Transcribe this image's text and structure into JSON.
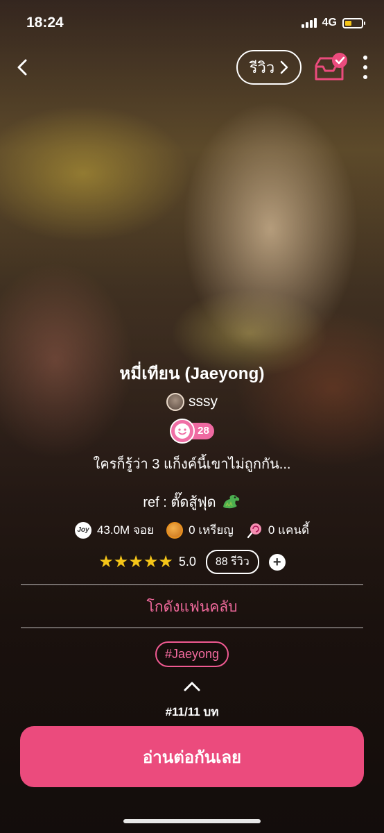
{
  "status_bar": {
    "time": "18:24",
    "network": "4G",
    "battery_color": "#f5c518"
  },
  "header": {
    "back_icon": "chevron-left-icon",
    "review_label": "รีวิว",
    "shelf_icon": "inbox-check-icon",
    "more_icon": "more-vertical-icon"
  },
  "story": {
    "title": "หมี่เทียน (Jaeyong)",
    "author": "sssy",
    "level": "28",
    "description": "ใครก็รู้ว่า 3 แก็งค์นี้เขาไม่ถูกกัน...",
    "ref": "ref : ตั๊ดสู้ฟุด",
    "ref_icon": "dragon-emoji-icon"
  },
  "stats": {
    "joy_icon_label": "Joy",
    "joy": "43.0M จอย",
    "coins": "0 เหรียญ",
    "candy": "0 แคนดี้"
  },
  "rating": {
    "stars": "★★★★★",
    "score": "5.0",
    "reviews": "88 รีวิว",
    "add": "+"
  },
  "fanclub_label": "โกดังแฟนคลับ",
  "tags": [
    "#Jaeyong"
  ],
  "episode": "#11/11 บท",
  "cta_label": "อ่านต่อกันเลย",
  "colors": {
    "accent": "#eb4b7d",
    "accent_text": "#f26a9d",
    "star": "#f5c518"
  }
}
